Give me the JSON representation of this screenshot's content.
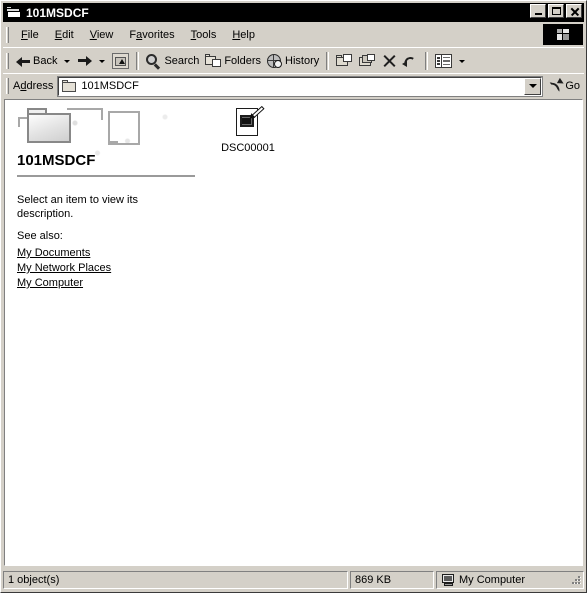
{
  "window": {
    "title": "101MSDCF",
    "title_icon": "folder-open-icon",
    "controls": {
      "minimize": "Minimize",
      "maximize": "Maximize",
      "close": "Close"
    }
  },
  "menu": {
    "items": [
      {
        "label": "File",
        "pre": "",
        "accel": "F",
        "post": "ile"
      },
      {
        "label": "Edit",
        "pre": "",
        "accel": "E",
        "post": "dit"
      },
      {
        "label": "View",
        "pre": "",
        "accel": "V",
        "post": "iew"
      },
      {
        "label": "Favorites",
        "pre": "F",
        "accel": "a",
        "post": "vorites"
      },
      {
        "label": "Tools",
        "pre": "",
        "accel": "T",
        "post": "ools"
      },
      {
        "label": "Help",
        "pre": "",
        "accel": "H",
        "post": "elp"
      }
    ],
    "brand_icon": "windows-flag-icon"
  },
  "toolbar": {
    "back_label": "Back",
    "forward_label": "",
    "up_label": "",
    "search_label": "Search",
    "folders_label": "Folders",
    "history_label": "History",
    "move_to_label": "",
    "copy_to_label": "",
    "delete_label": "",
    "undo_label": "",
    "views_label": ""
  },
  "address": {
    "label": "Address",
    "label_pre": "A",
    "label_accel": "d",
    "label_post": "dress",
    "value": "101MSDCF",
    "icon": "folder-icon",
    "go_label": "Go"
  },
  "webview": {
    "folder_title": "101MSDCF",
    "description": "Select an item to view its description.",
    "see_also_label": "See also:",
    "links": [
      {
        "label": "My Documents"
      },
      {
        "label": "My Network Places"
      },
      {
        "label": "My Computer"
      }
    ]
  },
  "files": [
    {
      "name": "DSC00001",
      "icon": "image-document-icon"
    }
  ],
  "statusbar": {
    "objects": "1 object(s)",
    "size": "869 KB",
    "zone": "My Computer",
    "zone_icon": "computer-icon"
  },
  "colors": {
    "window_face": "#d4d0c8",
    "titlebar": "#000000",
    "titlebar_text": "#ffffff",
    "content_bg": "#ffffff",
    "text": "#000000",
    "rule": "#9a9a9a"
  }
}
